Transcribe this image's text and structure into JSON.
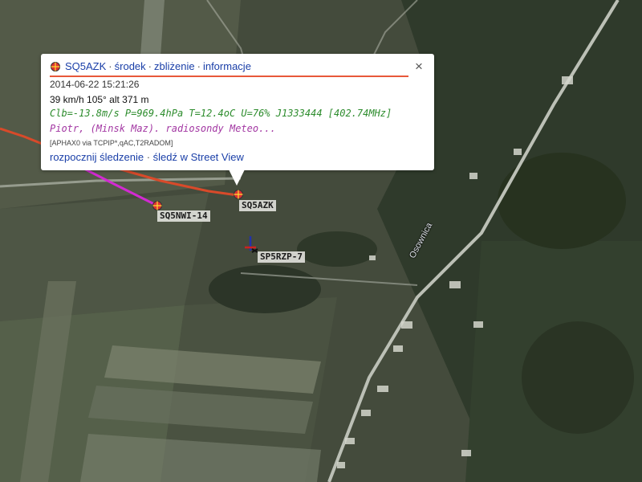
{
  "popup": {
    "callsign": "SQ5AZK",
    "links": [
      "środek",
      "zbliżenie",
      "informacje"
    ],
    "timestamp": "2014-06-22 15:21:26",
    "speed_course_alt": "39 km/h 105° alt 371 m",
    "telemetry": "Clb=-13.8m/s P=969.4hPa T=12.4oC U=76% J1333444 [402.74MHz]",
    "comment": "Piotr, (Minsk Maz). radiosondy Meteo...",
    "path": "[APHAX0 via TCPIP*,qAC,T2RADOM]",
    "actions": [
      "rozpocznij śledzenie",
      "śledź w Street View"
    ],
    "close_symbol": "×",
    "rule_color": "#e8583a"
  },
  "stations": [
    {
      "callsign": "SQ5AZK"
    },
    {
      "callsign": "SQ5NWI-14"
    },
    {
      "callsign": "SP5RZP-7"
    }
  ],
  "roads": [
    {
      "name": "Osownica"
    }
  ],
  "tracks": {
    "red_color": "#d84a2a",
    "magenta_color": "#d22ad2"
  }
}
